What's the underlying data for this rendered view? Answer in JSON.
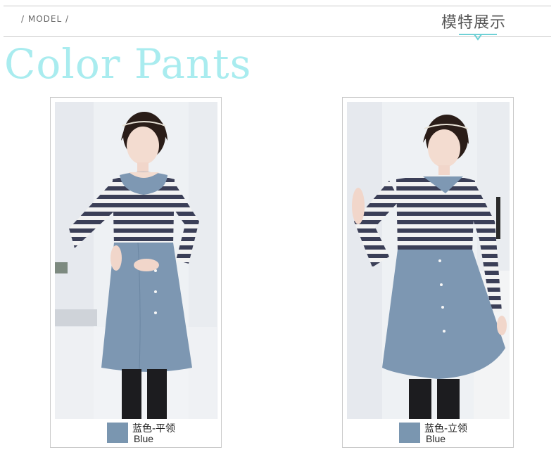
{
  "header": {
    "model_label": "/ MODEL /",
    "title_cn": "模特展示"
  },
  "section": {
    "title": "Color Pants"
  },
  "products": [
    {
      "color_cn": "蓝色-平领",
      "color_en": "Blue",
      "swatch": "#7a96b0"
    },
    {
      "color_cn": "蓝色-立领",
      "color_en": "Blue",
      "swatch": "#7a96b0"
    }
  ],
  "colors": {
    "accent_teal": "#6fd1d6",
    "title_script": "#a9ecef",
    "rule_gray": "#c9c9c9"
  }
}
